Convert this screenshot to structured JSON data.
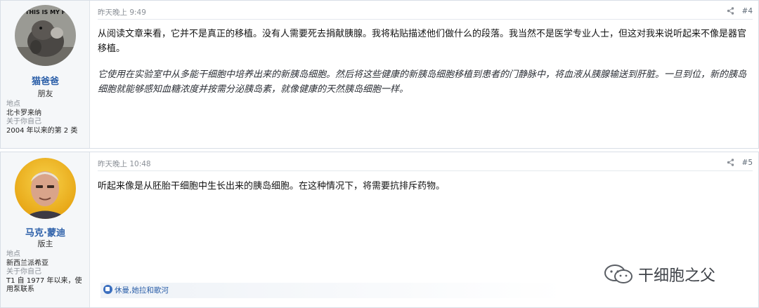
{
  "posts": [
    {
      "username": "猫爸爸",
      "user_title": "朋友",
      "location_label": "地点",
      "location": "北卡罗来纳",
      "about_label": "关于你自己",
      "about": "2004 年以来的第 2 类",
      "timestamp": "昨天晚上 9:49",
      "number": "#4",
      "share_icon": "share-icon",
      "paragraph": "从阅读文章来看，它并不是真正的移植。没有人需要死去捐献胰腺。我将粘贴描述他们做什么的段落。我当然不是医学专业人士，但这对我来说听起来不像是器官移植。",
      "quote": "它使用在实验室中从多能干细胞中培养出来的新胰岛细胞。然后将这些健康的新胰岛细胞移植到患者的门静脉中，将血液从胰腺输送到肝脏。一旦到位，新的胰岛细胞就能够感知血糖浓度并按需分泌胰岛素，就像健康的天然胰岛细胞一样。",
      "avatar_text": "THIS IS MY F"
    },
    {
      "username": "马克·蒙迪",
      "user_title": "版主",
      "location_label": "地点",
      "location": "新西兰派希亚",
      "about_label": "关于你自己",
      "about": "T1 自 1977 年以来，使用泵联系",
      "timestamp": "昨天晚上 10:48",
      "number": "#5",
      "share_icon": "share-icon",
      "paragraph": "听起来像是从胚胎干细胞中生长出来的胰岛细胞。在这种情况下，将需要抗排斥药物。",
      "likes": "休曼,她拉和歌河"
    }
  ],
  "watermark": "干细胞之父",
  "colors": {
    "username": "#2a5ea8",
    "meta": "#8a8f96",
    "sidebar_bg": "#f5f7f9"
  }
}
